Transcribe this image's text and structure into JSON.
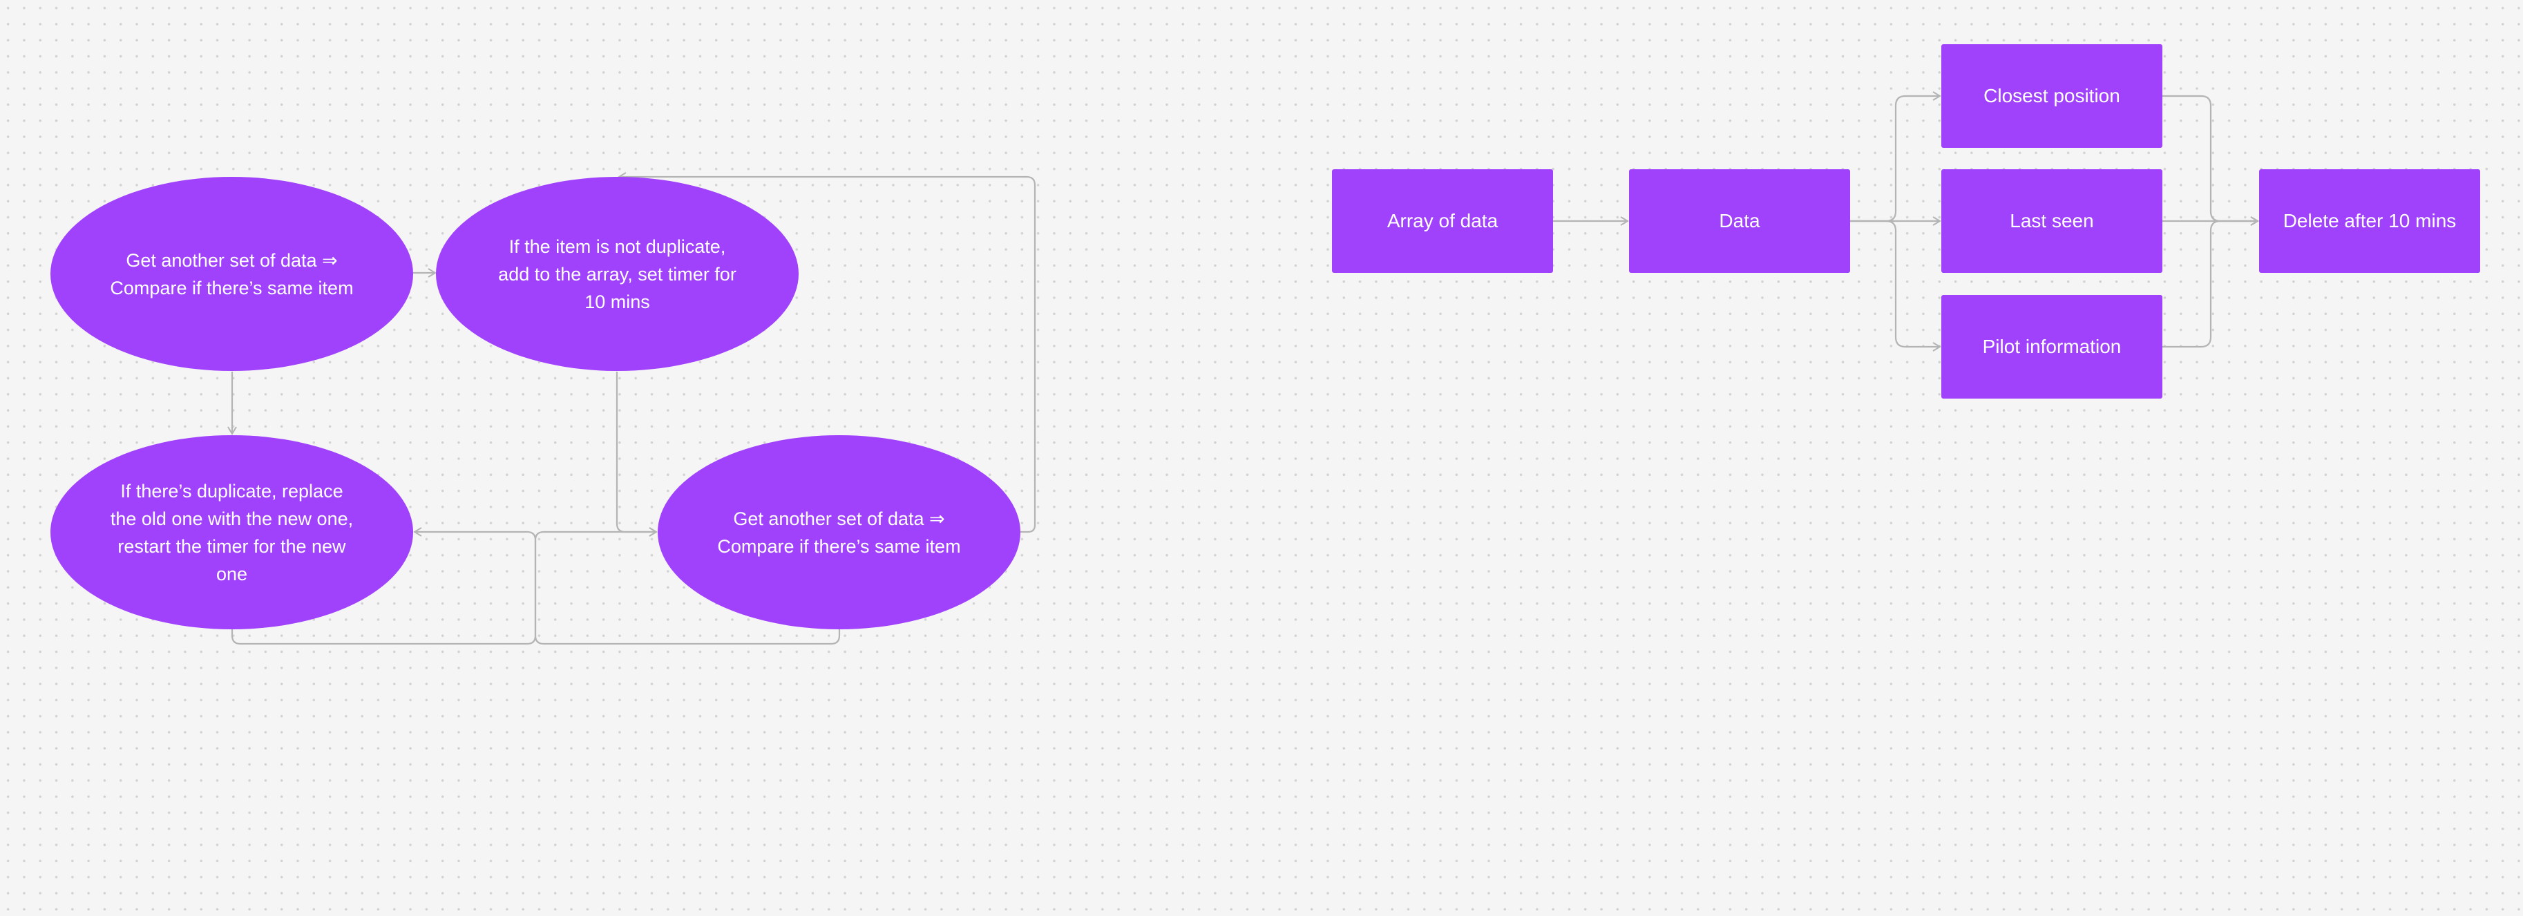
{
  "colors": {
    "node_fill": "#a042fc",
    "connector": "#b4b4b4",
    "text": "#ffffff",
    "canvas": "#f5f5f5"
  },
  "flowchart_left": {
    "nodes": {
      "compare_first": "Get another set of data ⇒\nCompare if there’s same item",
      "not_duplicate": "If the item is not duplicate,\nadd to the array, set timer for\n10 mins",
      "duplicate": "If there’s duplicate, replace\nthe old one with the new one,\nrestart the timer for the new\none",
      "compare_next": "Get another set of data ⇒\nCompare if there’s same item"
    }
  },
  "flowchart_right": {
    "nodes": {
      "array_of_data": "Array of data",
      "data": "Data",
      "closest_position": "Closest position",
      "last_seen": "Last seen",
      "pilot_information": "Pilot information",
      "delete_after": "Delete after 10 mins"
    }
  }
}
